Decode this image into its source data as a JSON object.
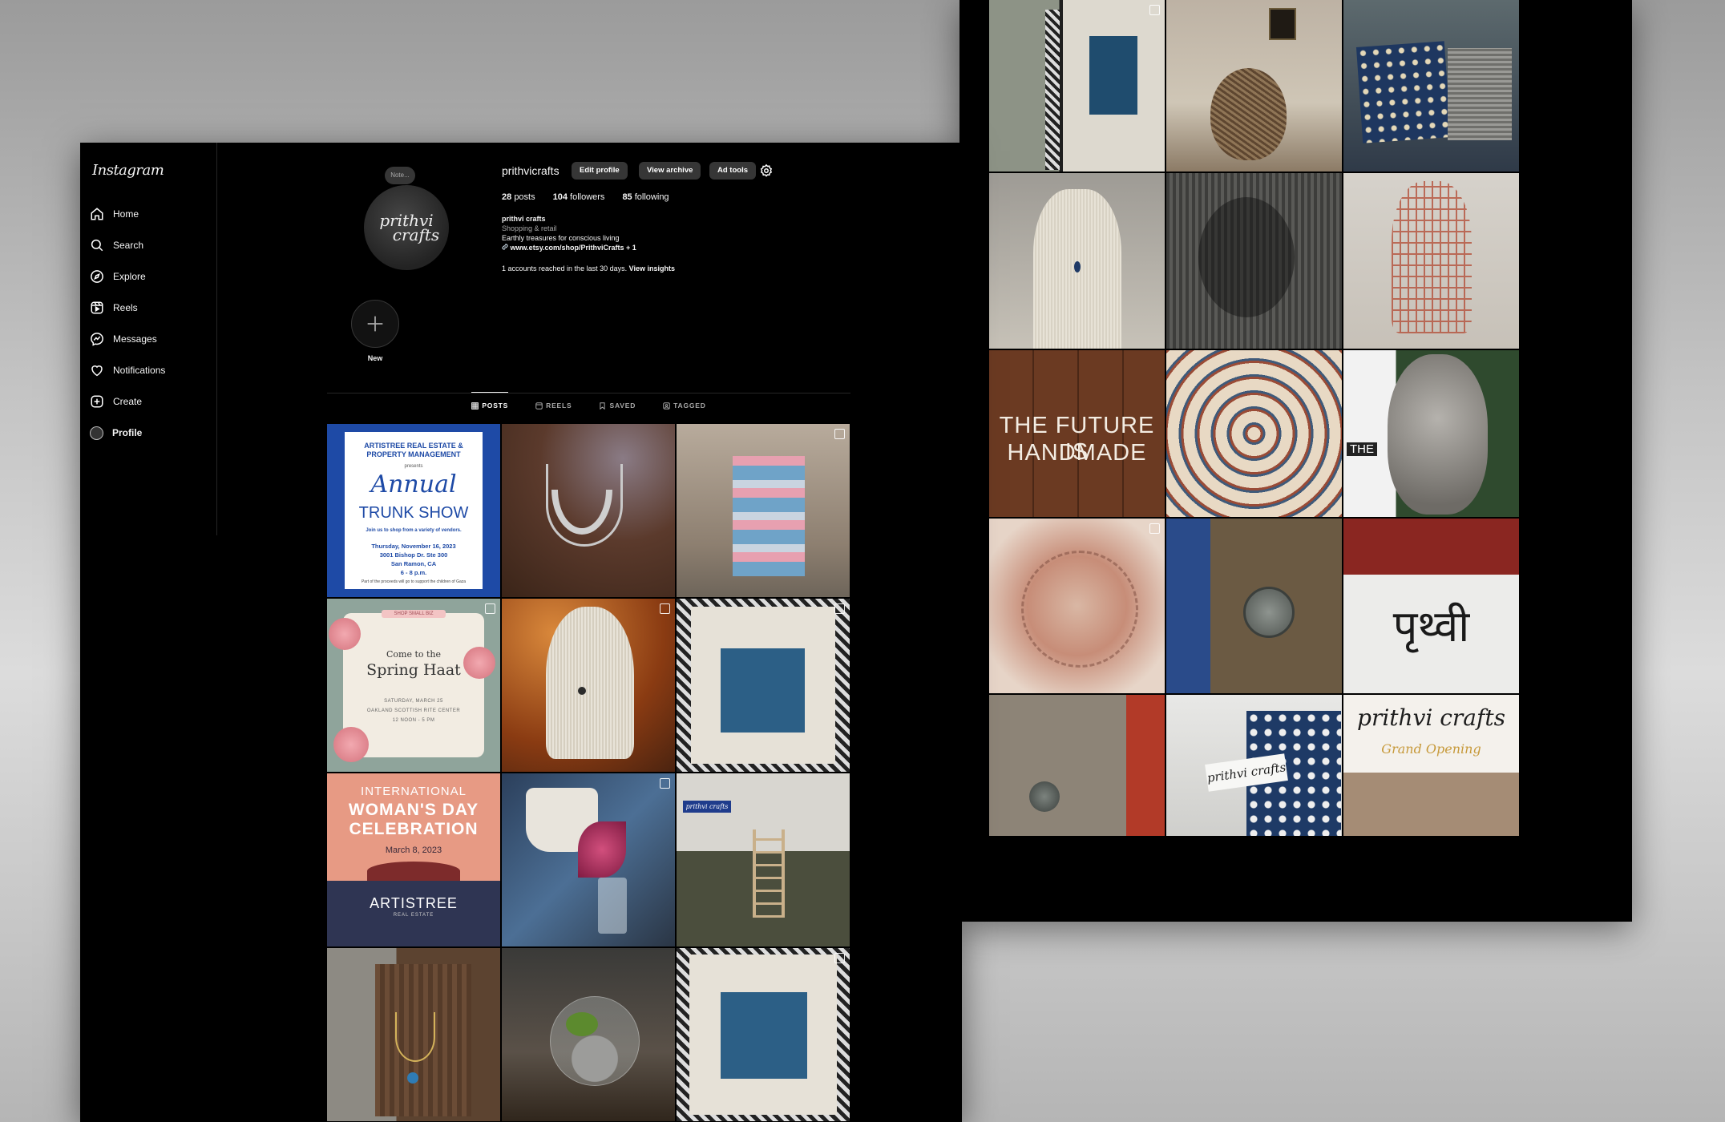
{
  "sidebar": {
    "logo": "Instagram",
    "items": [
      {
        "label": "Home",
        "icon": "home-icon"
      },
      {
        "label": "Search",
        "icon": "search-icon"
      },
      {
        "label": "Explore",
        "icon": "compass-icon"
      },
      {
        "label": "Reels",
        "icon": "reels-icon"
      },
      {
        "label": "Messages",
        "icon": "messenger-icon"
      },
      {
        "label": "Notifications",
        "icon": "heart-icon"
      },
      {
        "label": "Create",
        "icon": "plus-square-icon"
      },
      {
        "label": "Profile",
        "icon": "avatar"
      }
    ]
  },
  "profile": {
    "note": "Note...",
    "avatar_line1": "prithvi",
    "avatar_line2": "crafts",
    "username": "prithvicrafts",
    "edit_profile": "Edit profile",
    "view_archive": "View archive",
    "ad_tools": "Ad tools",
    "posts_count": "28",
    "posts_label": "posts",
    "followers_count": "104",
    "followers_label": "followers",
    "following_count": "85",
    "following_label": "following",
    "bio_name": "prithvi crafts",
    "bio_category": "Shopping & retail",
    "bio_text": "Earthly treasures for conscious living",
    "bio_link": "www.etsy.com/shop/PrithviCrafts + 1",
    "reach_text": "1 accounts reached in the last 30 days.",
    "reach_link": "View insights",
    "new_label": "New"
  },
  "tabs": [
    "POSTS",
    "REELS",
    "SAVED",
    "TAGGED"
  ],
  "posts_left": [
    {
      "name": "post-trunk-show",
      "texts": [
        "ARTISTREE REAL ESTATE & PROPERTY MANAGEMENT",
        "presents",
        "Annual",
        "TRUNK SHOW",
        "Join us to shop from a variety of vendors.",
        "Thursday, November 16, 2023",
        "3001 Bishop Dr. Ste 300",
        "San Ramon, CA",
        "6 - 8 p.m.",
        "Part of the proceeds will go to support the children of Gaza"
      ]
    },
    {
      "name": "post-necklace-wood",
      "texts": []
    },
    {
      "name": "post-textile-display",
      "texts": []
    },
    {
      "name": "post-spring-haat",
      "texts": [
        "SHOP SMALL BIZ",
        "Come to the",
        "Spring Haat",
        "SATURDAY, MARCH 25",
        "OAKLAND SCOTTISH RITE CENTER",
        "12 NOON - 5 PM"
      ]
    },
    {
      "name": "post-necklace-bust",
      "texts": []
    },
    {
      "name": "post-cyanotype-tote",
      "texts": []
    },
    {
      "name": "post-womens-day",
      "texts": [
        "INTERNATIONAL",
        "WOMAN'S DAY",
        "CELEBRATION",
        "March 8, 2023",
        "ARTISTREE",
        "REAL ESTATE"
      ]
    },
    {
      "name": "post-plant-vase",
      "texts": []
    },
    {
      "name": "post-market-booth",
      "texts": [
        "prithvi crafts"
      ]
    },
    {
      "name": "post-necklaces-board",
      "texts": []
    },
    {
      "name": "post-terrarium",
      "texts": []
    },
    {
      "name": "post-cyanotype-tote-2",
      "texts": []
    }
  ],
  "posts_right": [
    {
      "name": "post-botanical-prints",
      "texts": []
    },
    {
      "name": "post-woven-vase",
      "texts": []
    },
    {
      "name": "post-block-print-pillows",
      "texts": []
    },
    {
      "name": "post-pendant-bust",
      "texts": []
    },
    {
      "name": "post-shadow-curtain",
      "texts": []
    },
    {
      "name": "post-hand-sculpture",
      "texts": []
    },
    {
      "name": "post-future-handmade",
      "texts": [
        "THE FUTURE IS",
        "HANDMADE"
      ]
    },
    {
      "name": "post-mandala",
      "texts": []
    },
    {
      "name": "post-buddha-head",
      "texts": [
        "THE"
      ]
    },
    {
      "name": "post-ganesha-fresco",
      "texts": []
    },
    {
      "name": "post-coin-pendant",
      "texts": []
    },
    {
      "name": "post-prithvi-script",
      "texts": [
        "पृथ्वी"
      ]
    },
    {
      "name": "post-pendant-red",
      "texts": []
    },
    {
      "name": "post-gift-tag",
      "texts": [
        "prithvi crafts"
      ]
    },
    {
      "name": "post-grand-opening",
      "texts": [
        "prithvi crafts",
        "Grand Opening"
      ]
    }
  ]
}
